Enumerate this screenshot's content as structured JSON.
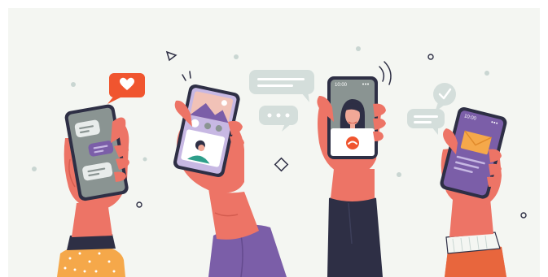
{
  "illustration": {
    "icons": [
      "heart-icon",
      "check-icon",
      "phone-hangup-icon",
      "envelope-icon",
      "signal-waves-icon"
    ],
    "phones": [
      {
        "name": "chat-phone",
        "screen": "chat"
      },
      {
        "name": "gallery-phone",
        "screen": "photos"
      },
      {
        "name": "video-call-phone",
        "screen": "video-call",
        "status_time": "10:00"
      },
      {
        "name": "mail-phone",
        "screen": "email",
        "status_time": "10:00"
      }
    ],
    "colors": {
      "background": "#f4f6f2",
      "phone_body": "#2e2f45",
      "screen": "#8a9492",
      "skin": "#ed7466",
      "accent_orange": "#f0552f",
      "purple": "#7b5ea8",
      "bubble_gray": "#d4dedb"
    }
  }
}
